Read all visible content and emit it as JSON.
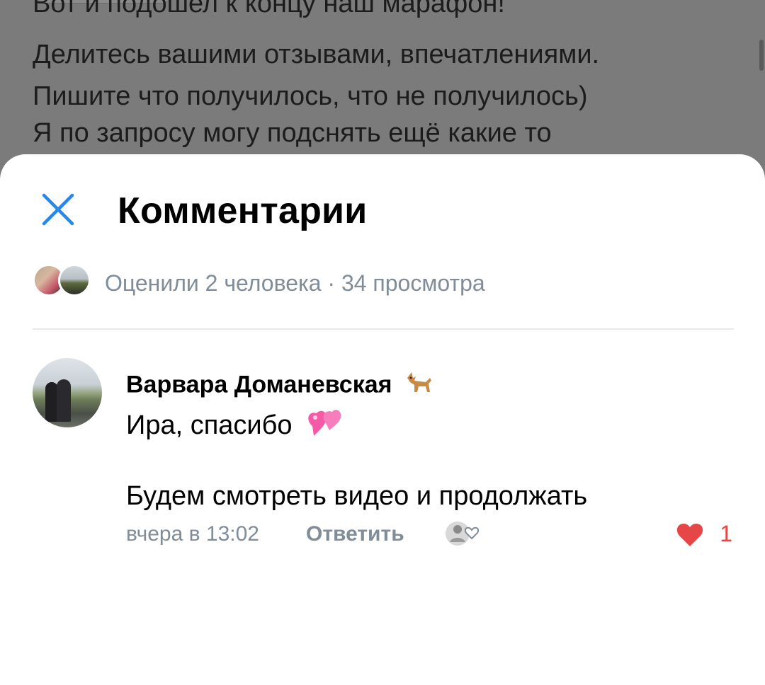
{
  "background_post": {
    "lines": [
      "Вот и подошел к концу наш марафон!",
      "Делитесь вашими отзывами, впечатлениями.",
      "Пишите что получилось, что не получилось)",
      "Я по запросу могу подснять ещё какие то"
    ]
  },
  "sheet": {
    "title": "Комментарии",
    "close_icon": "close-icon",
    "likes_summary": "Оценили 2 человека · 34 просмотра"
  },
  "comment": {
    "author": "Варвара Доманевская",
    "author_emoji": "dog-emoji",
    "line1": "Ира, спасибо",
    "line1_emoji": "two-hearts-emoji",
    "line2": "Будем смотреть видео и продолжать",
    "time": "вчера в 13:02",
    "reply_label": "Ответить",
    "like_count": "1"
  },
  "colors": {
    "accent": "#2688eb",
    "secondary_text": "#818c99",
    "like_red": "#e64646",
    "overlay": "#7a7a7a"
  }
}
